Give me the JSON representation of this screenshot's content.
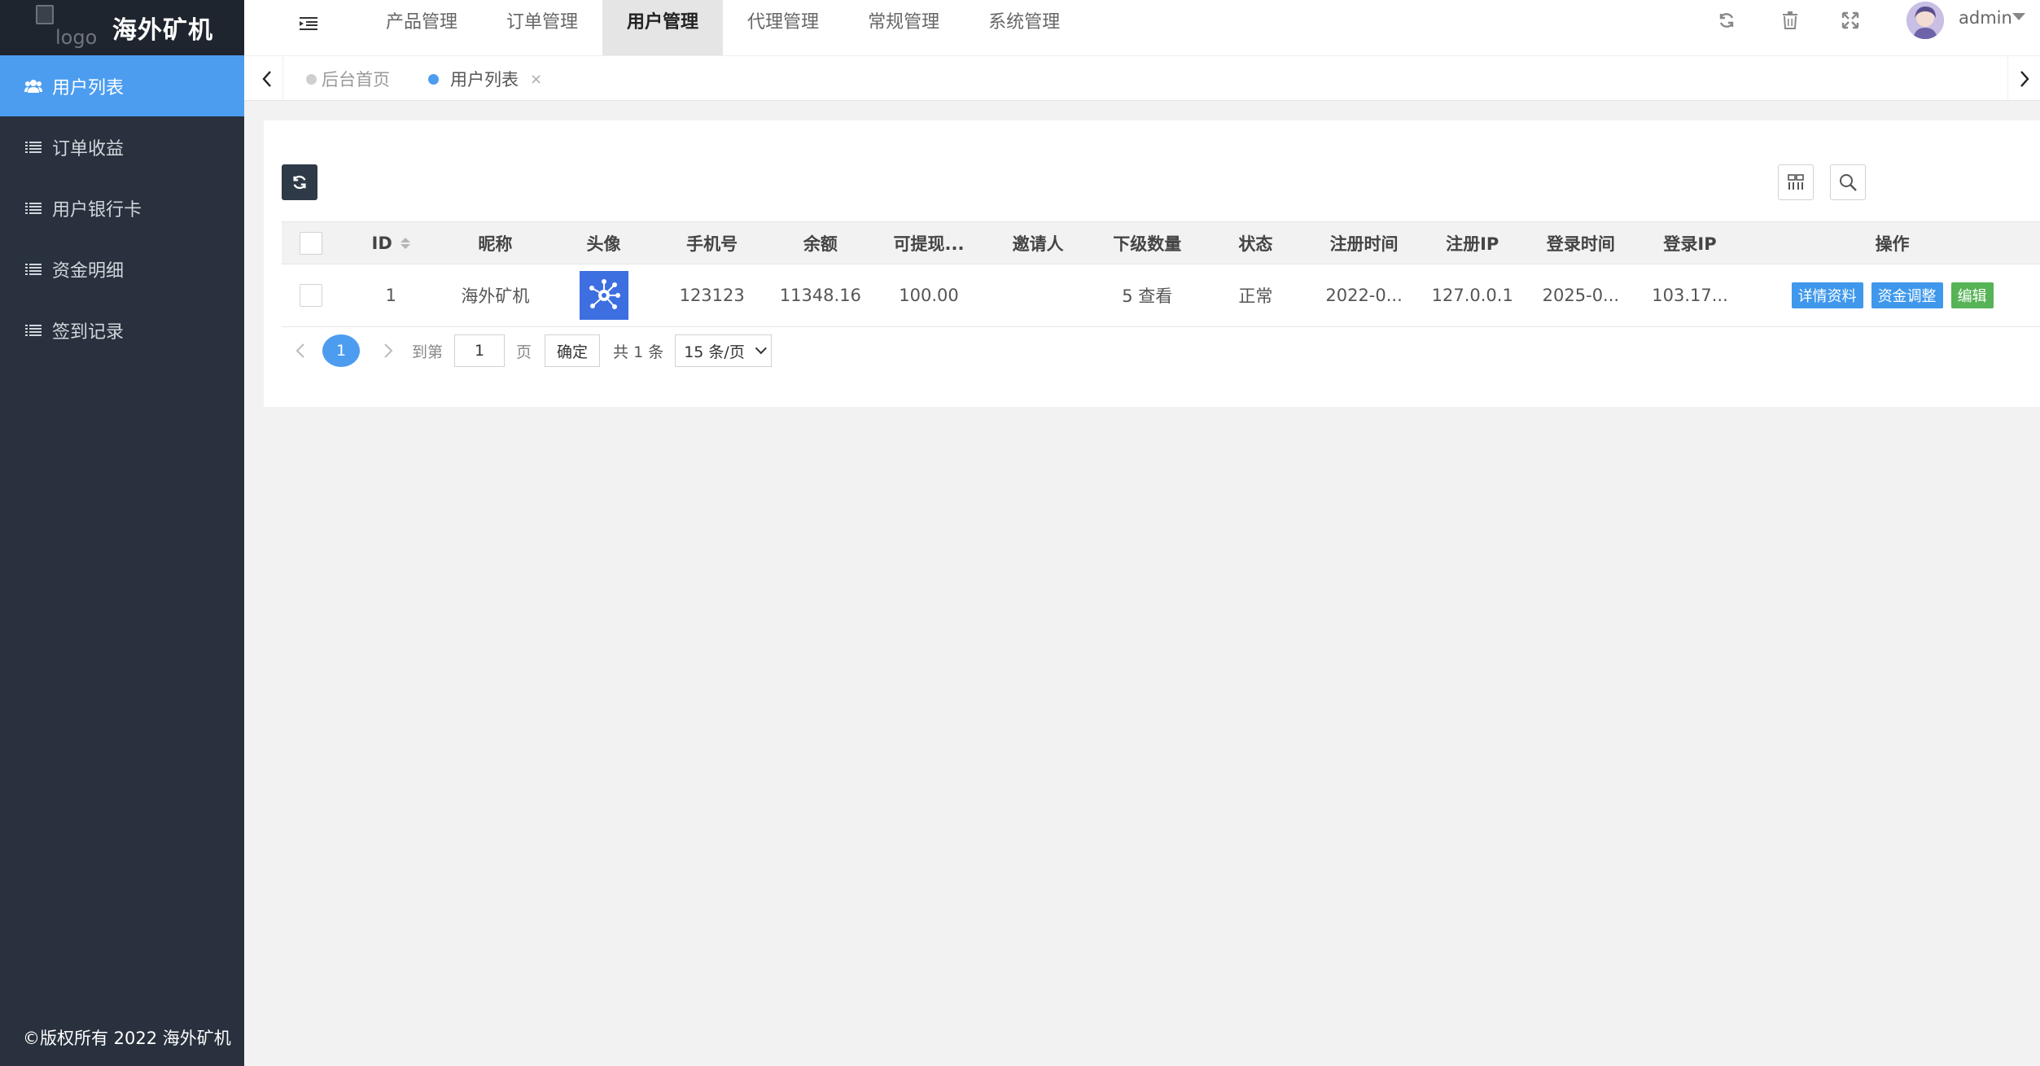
{
  "brand": {
    "logo_alt": "logo",
    "title": "海外矿机"
  },
  "sidebar": {
    "items": [
      {
        "label": "用户列表",
        "icon": "users-icon",
        "active": true
      },
      {
        "label": "订单收益",
        "icon": "list-icon"
      },
      {
        "label": "用户银行卡",
        "icon": "list-icon"
      },
      {
        "label": "资金明细",
        "icon": "list-icon"
      },
      {
        "label": "签到记录",
        "icon": "list-icon"
      }
    ],
    "copyright": "©版权所有 2022 海外矿机"
  },
  "header": {
    "nav": [
      "产品管理",
      "订单管理",
      "用户管理",
      "代理管理",
      "常规管理",
      "系统管理"
    ],
    "active_nav": "用户管理",
    "user": "admin"
  },
  "tabs": [
    {
      "label": "后台首页",
      "active": false
    },
    {
      "label": "用户列表",
      "active": true,
      "close": "×"
    }
  ],
  "table": {
    "columns": [
      "ID",
      "昵称",
      "头像",
      "手机号",
      "余额",
      "可提现...",
      "邀请人",
      "下级数量",
      "状态",
      "注册时间",
      "注册IP",
      "登录时间",
      "登录IP",
      "操作"
    ],
    "rows": [
      {
        "id": "1",
        "nickname": "海外矿机",
        "phone": "123123",
        "balance": "11348.16",
        "withdrawable": "100.00",
        "inviter": "",
        "sub_count": "5 查看",
        "status": "正常",
        "reg_time": "2022-0...",
        "reg_ip": "127.0.0.1",
        "login_time": "2025-0...",
        "login_ip": "103.17...",
        "actions": [
          "详情资料",
          "资金调整",
          "编辑"
        ]
      }
    ]
  },
  "pagination": {
    "current": "1",
    "goto_label": "到第",
    "page_value": "1",
    "page_unit": "页",
    "confirm": "确定",
    "total": "共 1 条",
    "page_size": "15 条/页"
  },
  "colors": {
    "accent": "#4c9df0",
    "sidebar_bg": "#28313d",
    "green": "#56b356"
  }
}
